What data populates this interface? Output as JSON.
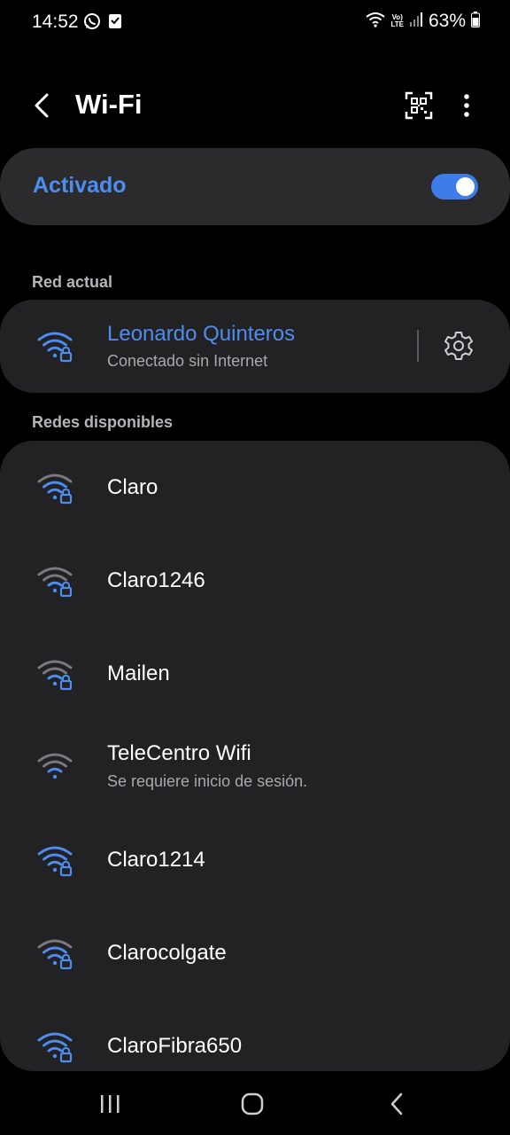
{
  "status_bar": {
    "time": "14:52",
    "battery": "63%",
    "volte_top": "Vo)",
    "volte_bottom": "LTE",
    "icons": [
      "whatsapp-icon",
      "download-icon",
      "wifi-icon",
      "signal-icon",
      "battery-icon"
    ]
  },
  "app_bar": {
    "title": "Wi-Fi",
    "icons": [
      "back-arrow-icon",
      "qr-code-icon",
      "more-vert-icon"
    ]
  },
  "master_toggle": {
    "label": "Activado",
    "on": true
  },
  "current_section": {
    "label": "Red actual",
    "network": {
      "name": "Leonardo Quinteros",
      "status": "Conectado sin Internet",
      "icon": "wifi-lock-icon"
    }
  },
  "available_section": {
    "label": "Redes disponibles",
    "networks": [
      {
        "name": "Claro",
        "sub": "",
        "secured": true
      },
      {
        "name": "Claro1246",
        "sub": "",
        "secured": true
      },
      {
        "name": "Mailen",
        "sub": "",
        "secured": true
      },
      {
        "name": "TeleCentro Wifi",
        "sub": "Se requiere inicio de sesión.",
        "secured": false
      },
      {
        "name": "Claro1214",
        "sub": "",
        "secured": true
      },
      {
        "name": "Clarocolgate",
        "sub": "",
        "secured": true
      },
      {
        "name": "ClaroFibra650",
        "sub": "",
        "secured": true
      }
    ]
  },
  "nav_bar": {
    "icons": [
      "recents-icon",
      "home-icon",
      "back-icon"
    ]
  },
  "colors": {
    "accent": "#4e8df0",
    "card": "#222224",
    "toggle_card": "#2b2b2e",
    "background": "#000000"
  }
}
